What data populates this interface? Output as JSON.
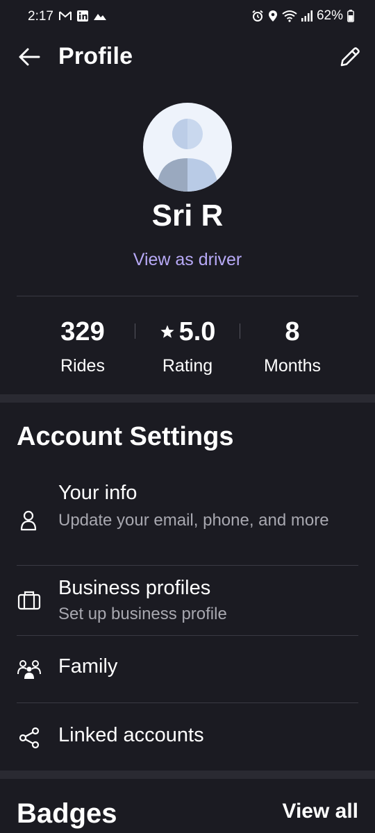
{
  "status_bar": {
    "time": "2:17",
    "battery": "62%",
    "left_icons": [
      "gmail-icon",
      "linkedin-icon",
      "cloud-icon"
    ],
    "right_icons": [
      "alarm-icon",
      "location-icon",
      "wifi-icon",
      "signal-icon",
      "battery-icon"
    ]
  },
  "header": {
    "title": "Profile"
  },
  "profile": {
    "name": "Sri R",
    "driver_link": "View as driver"
  },
  "stats": [
    {
      "value": "329",
      "label": "Rides"
    },
    {
      "value": "5.0",
      "label": "Rating",
      "icon": "star-icon"
    },
    {
      "value": "8",
      "label": "Months"
    }
  ],
  "account_settings": {
    "title": "Account Settings",
    "items": [
      {
        "title": "Your info",
        "subtitle": "Update your email, phone, and more",
        "icon": "person-icon"
      },
      {
        "title": "Business profiles",
        "subtitle": "Set up business profile",
        "icon": "briefcase-icon"
      },
      {
        "title": "Family",
        "icon": "family-icon"
      },
      {
        "title": "Linked accounts",
        "icon": "share-icon"
      }
    ]
  },
  "badges": {
    "title": "Badges",
    "view_all": "View all"
  },
  "colors": {
    "background": "#1b1b22",
    "accent_link": "#b7a9f6",
    "divider": "#3a3a44",
    "section_band": "#2a2a32",
    "subtitle": "#a8a8b0"
  }
}
